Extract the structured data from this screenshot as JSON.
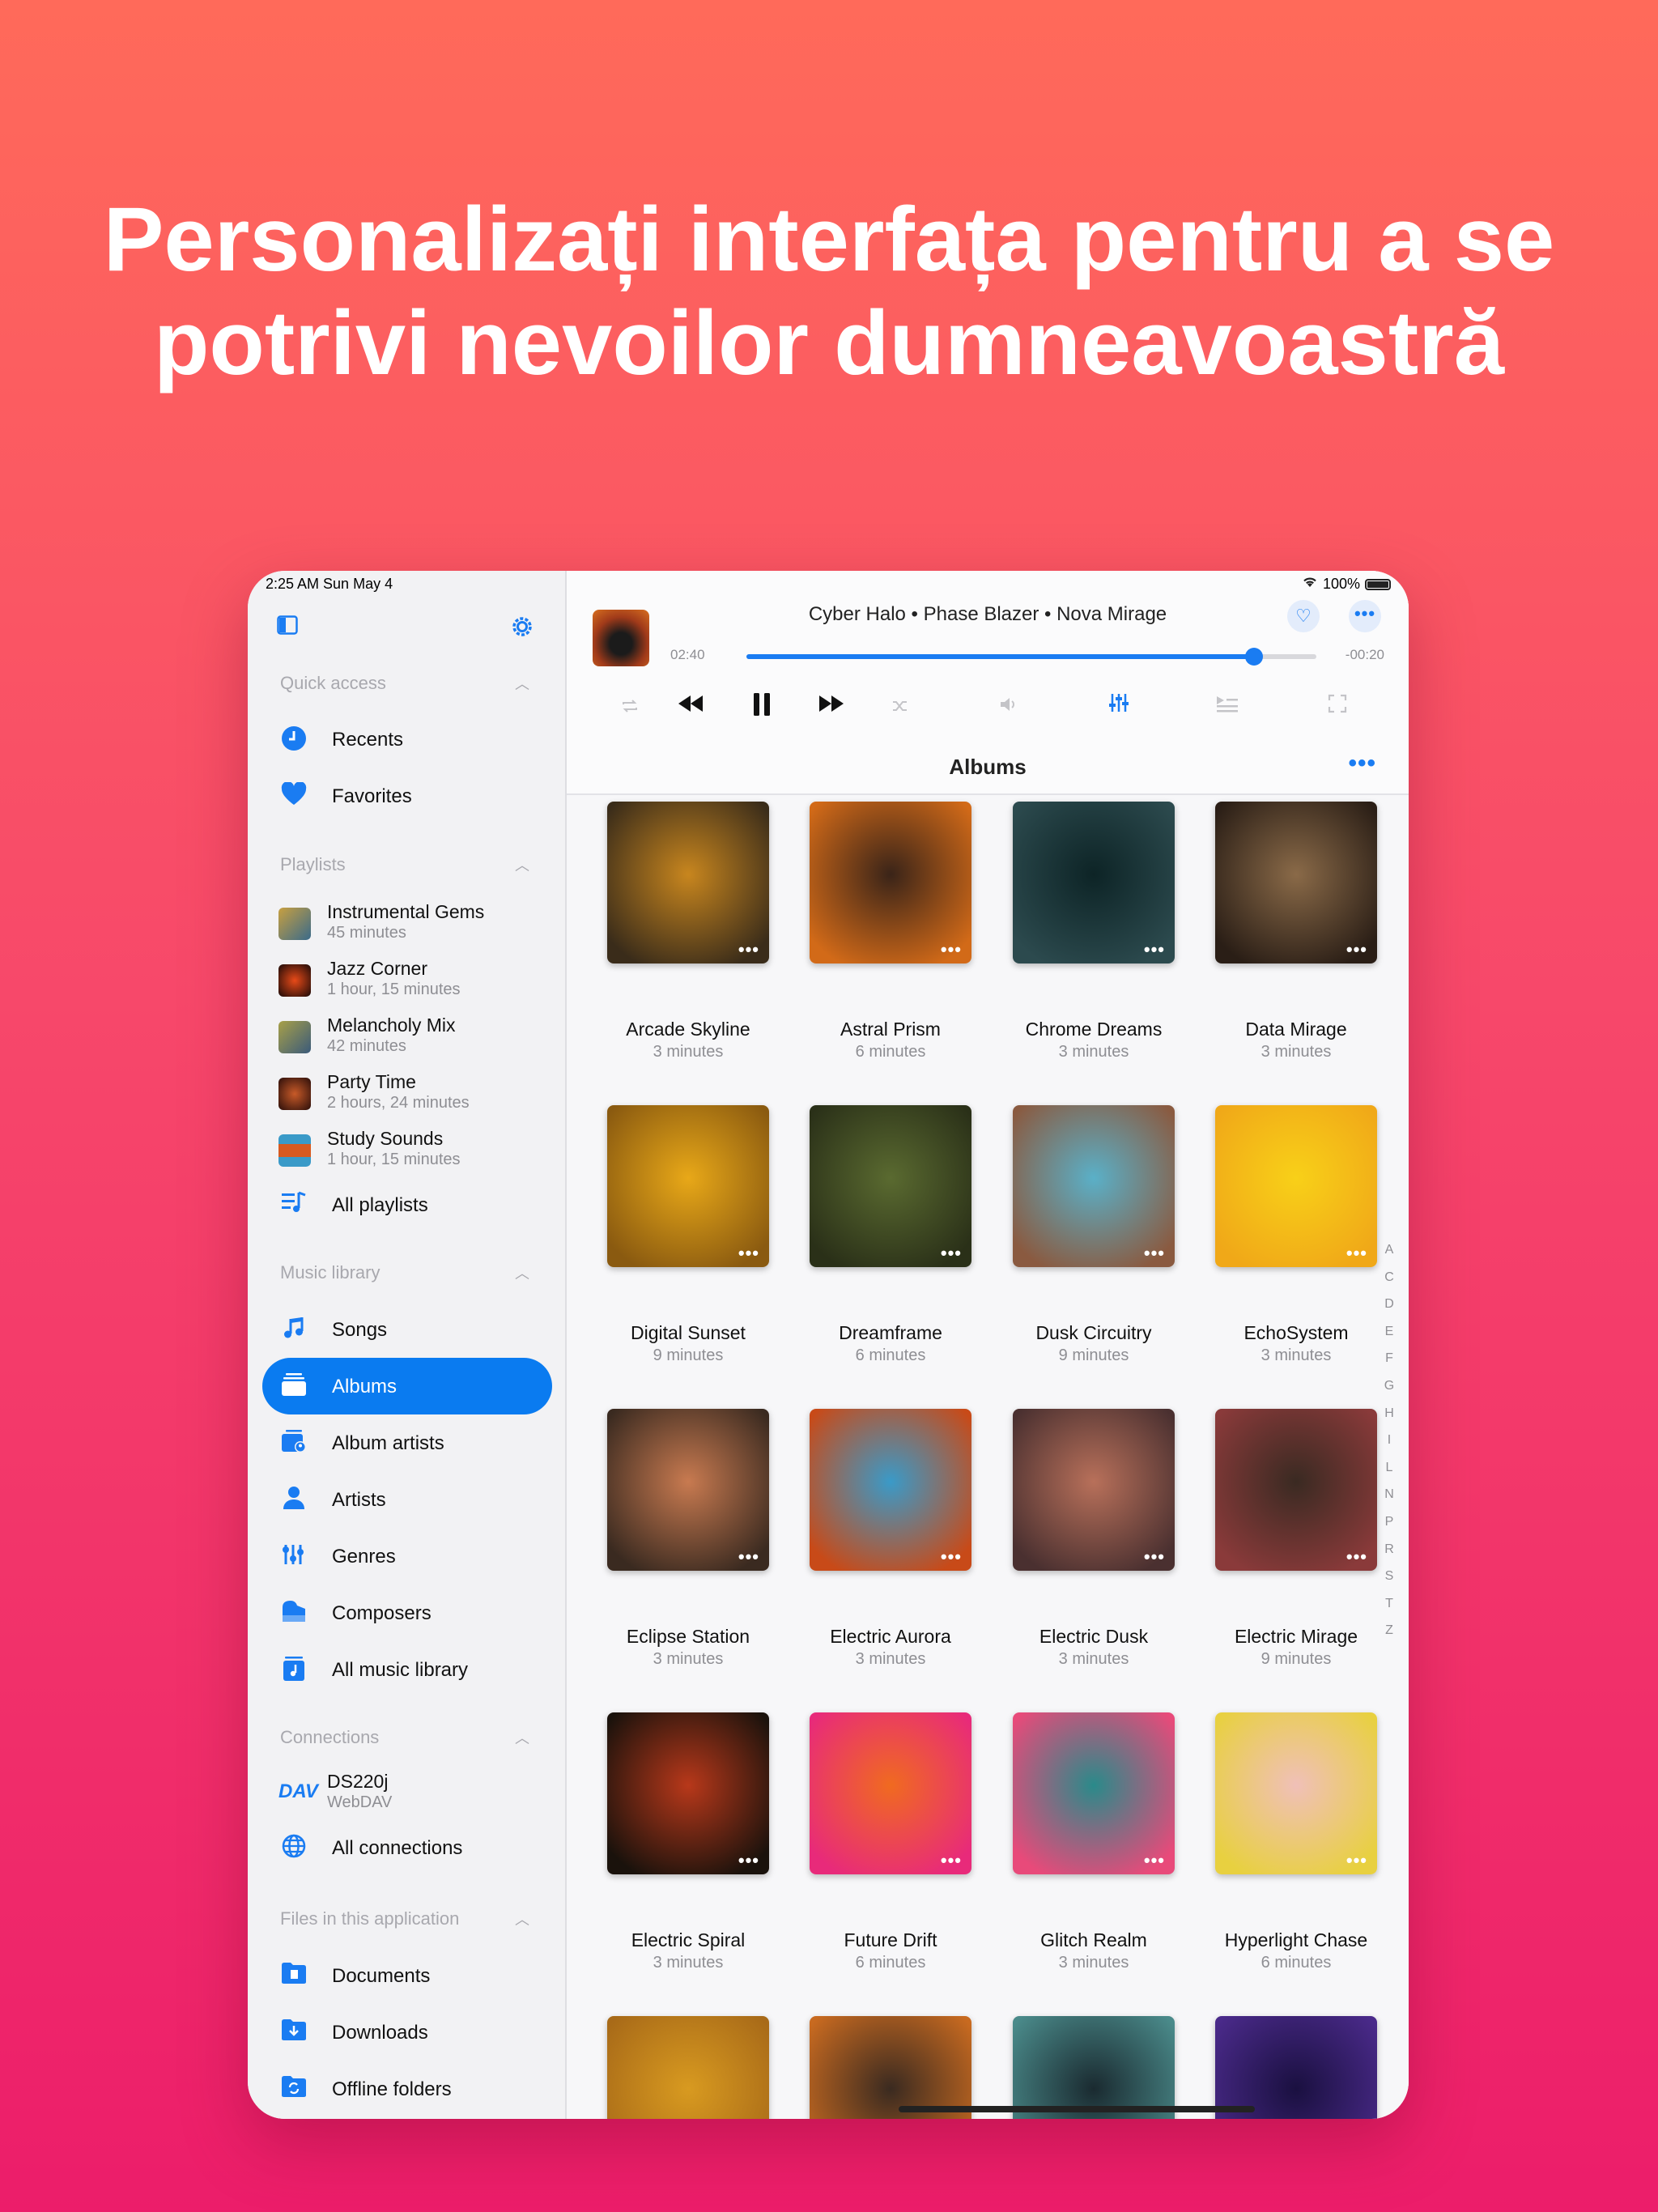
{
  "headline": [
    "Personalizați interfața pentru a se",
    "potrivi nevoilor dumneavoastră"
  ],
  "status": {
    "time": "2:25 AM  Sun May 4",
    "battery": "100%"
  },
  "sidebar": {
    "quick_access": {
      "header": "Quick access",
      "items": [
        {
          "label": "Recents",
          "icon": "clock-icon"
        },
        {
          "label": "Favorites",
          "icon": "heart-icon"
        }
      ]
    },
    "playlists": {
      "header": "Playlists",
      "items": [
        {
          "name": "Instrumental Gems",
          "sub": "45 minutes",
          "color": "#7a8a3a"
        },
        {
          "name": "Jazz Corner",
          "sub": "1 hour, 15 minutes",
          "color": "#8a2a1a"
        },
        {
          "name": "Melancholy Mix",
          "sub": "42 minutes",
          "color": "#6a7a3a"
        },
        {
          "name": "Party Time",
          "sub": "2 hours, 24 minutes",
          "color": "#5a1a1a"
        },
        {
          "name": "Study Sounds",
          "sub": "1 hour, 15 minutes",
          "color": "#d86a2a"
        }
      ],
      "all_label": "All playlists"
    },
    "music_library": {
      "header": "Music library",
      "items": [
        {
          "label": "Songs",
          "icon": "music-note-icon"
        },
        {
          "label": "Albums",
          "icon": "albums-icon",
          "active": true
        },
        {
          "label": "Album artists",
          "icon": "album-artist-icon"
        },
        {
          "label": "Artists",
          "icon": "person-icon"
        },
        {
          "label": "Genres",
          "icon": "genres-icon"
        },
        {
          "label": "Composers",
          "icon": "piano-icon"
        },
        {
          "label": "All music library",
          "icon": "library-icon"
        }
      ]
    },
    "connections": {
      "header": "Connections",
      "server": {
        "name": "DS220j",
        "sub": "WebDAV",
        "icon_text": "DAV"
      },
      "all_label": "All connections"
    },
    "files": {
      "header": "Files in this application",
      "items": [
        {
          "label": "Documents",
          "icon": "folder-doc-icon"
        },
        {
          "label": "Downloads",
          "icon": "folder-download-icon"
        },
        {
          "label": "Offline folders",
          "icon": "folder-sync-icon"
        }
      ]
    }
  },
  "player": {
    "now_playing": "Cyber Halo • Phase Blazer • Nova Mirage",
    "elapsed": "02:40",
    "remaining": "-00:20",
    "progress": 0.89
  },
  "albums_header": "Albums",
  "albums": [
    {
      "name": "Arcade Skyline",
      "dur": "3 minutes",
      "c1": "#c8861e",
      "c2": "#3a2c1a"
    },
    {
      "name": "Astral Prism",
      "dur": "6 minutes",
      "c1": "#3a2418",
      "c2": "#d26a18"
    },
    {
      "name": "Chrome Dreams",
      "dur": "3 minutes",
      "c1": "#0d2426",
      "c2": "#2c4a4e"
    },
    {
      "name": "Data Mirage",
      "dur": "3 minutes",
      "c1": "#8a6a48",
      "c2": "#2a1e16"
    },
    {
      "name": "Digital Sunset",
      "dur": "9 minutes",
      "c1": "#e8a818",
      "c2": "#8a5a10"
    },
    {
      "name": "Dreamframe",
      "dur": "6 minutes",
      "c1": "#5a6a30",
      "c2": "#2a3018"
    },
    {
      "name": "Dusk Circuitry",
      "dur": "9 minutes",
      "c1": "#5ab0c8",
      "c2": "#8a5a40"
    },
    {
      "name": "EchoSystem",
      "dur": "3 minutes",
      "c1": "#f8d018",
      "c2": "#f0a818"
    },
    {
      "name": "Eclipse Station",
      "dur": "3 minutes",
      "c1": "#c87a50",
      "c2": "#3a2a20"
    },
    {
      "name": "Electric Aurora",
      "dur": "3 minutes",
      "c1": "#3a9ac8",
      "c2": "#c84a18"
    },
    {
      "name": "Electric Dusk",
      "dur": "3 minutes",
      "c1": "#b8705a",
      "c2": "#4a3030"
    },
    {
      "name": "Electric Mirage",
      "dur": "9 minutes",
      "c1": "#3a2a22",
      "c2": "#8a3a3a"
    },
    {
      "name": "Electric Spiral",
      "dur": "3 minutes",
      "c1": "#b8381a",
      "c2": "#1a120c"
    },
    {
      "name": "Future Drift",
      "dur": "6 minutes",
      "c1": "#f06a20",
      "c2": "#e82a7a"
    },
    {
      "name": "Glitch Realm",
      "dur": "3 minutes",
      "c1": "#2a8a8a",
      "c2": "#e84a7a"
    },
    {
      "name": "Hyperlight Chase",
      "dur": "6 minutes",
      "c1": "#f0c0b8",
      "c2": "#e8d040"
    },
    {
      "name": "",
      "dur": "",
      "c1": "#d89a20",
      "c2": "#a86a18"
    },
    {
      "name": "",
      "dur": "",
      "c1": "#3a2a20",
      "c2": "#c86a20"
    },
    {
      "name": "",
      "dur": "",
      "c1": "#1a2a30",
      "c2": "#4a8a8a"
    },
    {
      "name": "",
      "dur": "",
      "c1": "#1a1040",
      "c2": "#4a2a8a"
    }
  ],
  "index_letters": [
    "A",
    "C",
    "D",
    "E",
    "F",
    "G",
    "H",
    "I",
    "L",
    "N",
    "P",
    "R",
    "S",
    "T",
    "Z"
  ],
  "colors": {
    "accent": "#1a7cf2",
    "active_bg": "#0a7bf0"
  }
}
